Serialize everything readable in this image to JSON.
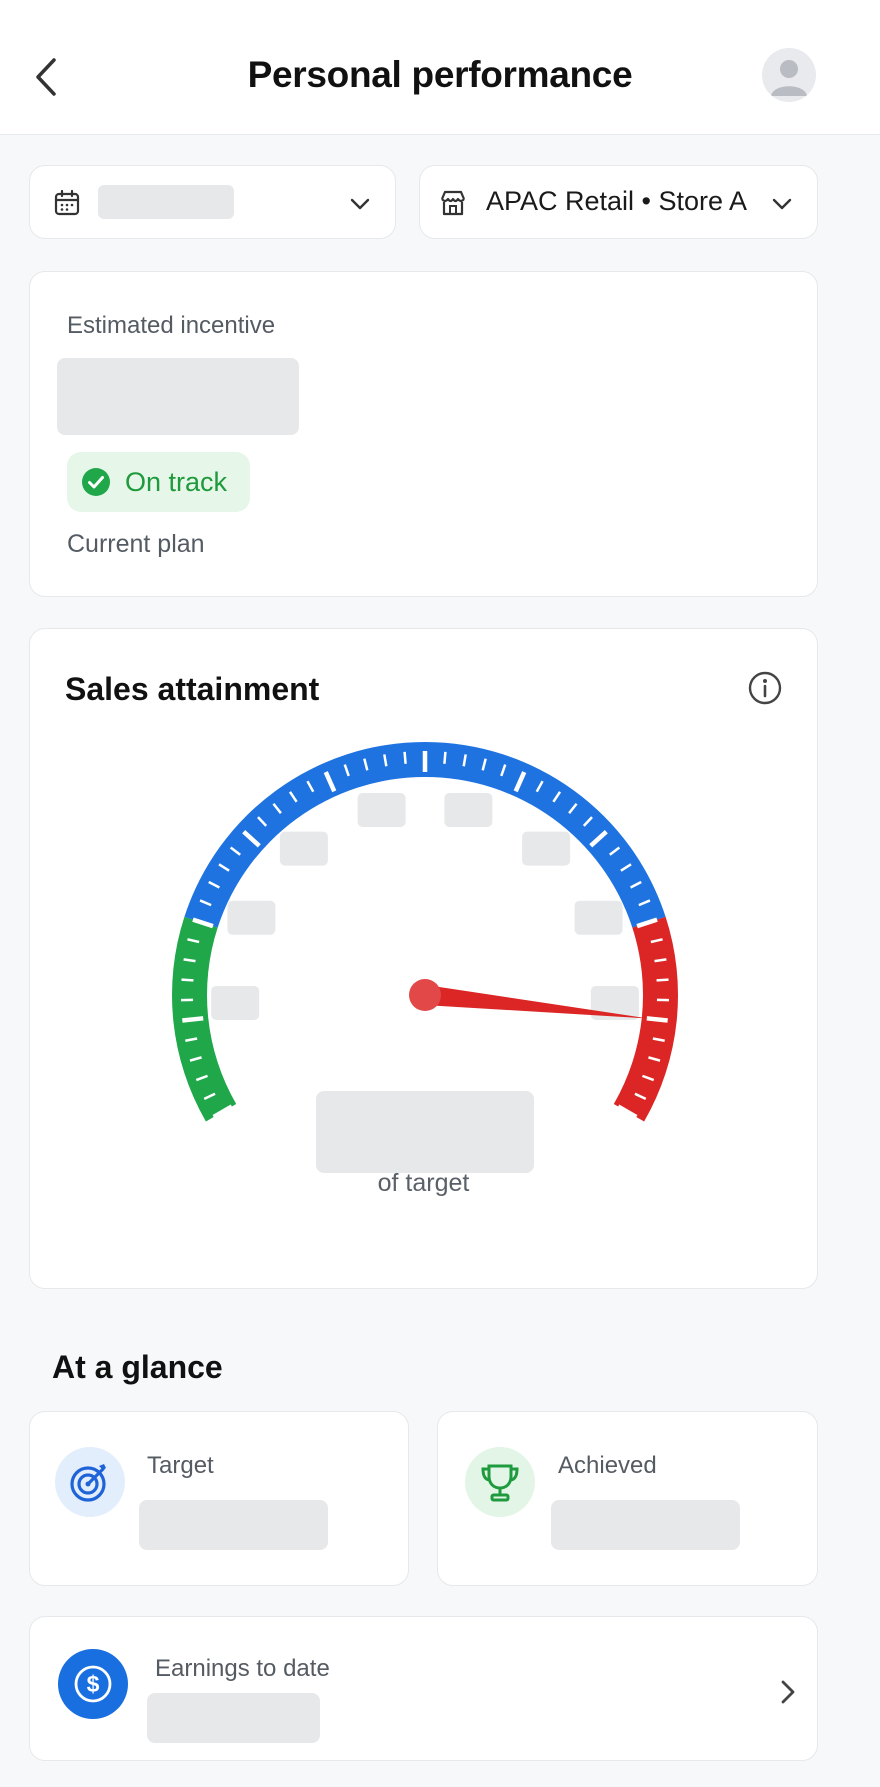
{
  "header": {
    "title": "Personal performance",
    "back_icon": "chevron-left-icon",
    "avatar_icon": "user-icon"
  },
  "filters": {
    "period_icon": "calendar-icon",
    "period_value": "",
    "store_icon": "store-icon",
    "store_value": "APAC Retail • Store A",
    "chevron_icon": "chevron-down-icon"
  },
  "incentive": {
    "label": "Estimated incentive",
    "amount": "",
    "status": "On track",
    "status_icon": "check-circle-icon",
    "plan": "Current plan"
  },
  "attainment": {
    "title": "Sales attainment",
    "info_icon": "info-icon",
    "value": "",
    "caption": "of target"
  },
  "glance": {
    "title": "At a glance",
    "target_label": "Target",
    "target_icon": "target-icon",
    "target_value": "",
    "achieved_label": "Achieved",
    "achieved_icon": "trophy-icon",
    "achieved_value": "",
    "earnings_label": "Earnings to date",
    "earnings_icon": "dollar-icon",
    "earnings_value": ""
  },
  "colors": {
    "gauge_low": "#1fa74a",
    "gauge_mid": "#1f73e0",
    "gauge_high": "#dc2626",
    "needle": "#dc2626",
    "status_text": "#1e9a3c",
    "status_bg": "#e6f6e8"
  },
  "chart_data": {
    "type": "gauge",
    "value_fraction": 0.9,
    "zones": [
      {
        "from": 0.0,
        "to": 0.2,
        "color": "#1fa74a"
      },
      {
        "from": 0.2,
        "to": 0.8,
        "color": "#1f73e0"
      },
      {
        "from": 0.8,
        "to": 1.0,
        "color": "#dc2626"
      }
    ],
    "sweep_degrees": 240
  }
}
